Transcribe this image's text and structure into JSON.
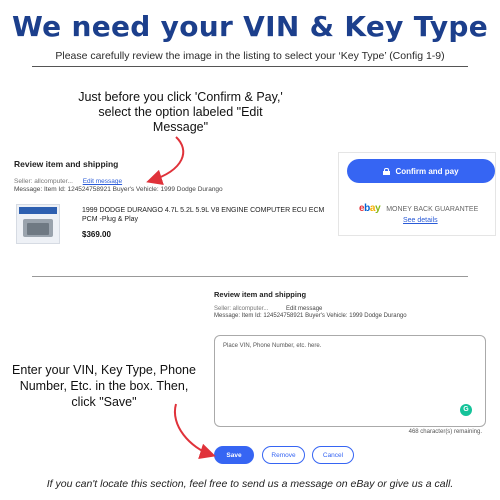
{
  "header": {
    "title": "We need your VIN & Key Type",
    "subtitle": "Please carefully review the image in the listing to select your ‘Key Type’ (Config 1-9)"
  },
  "callouts": {
    "top": "Just before you click 'Confirm & Pay,' select the option labeled \"Edit Message\"",
    "bottom": "Enter your VIN, Key Type, Phone Number, Etc.  in the box. Then, click \"Save\""
  },
  "checkout": {
    "section_title": "Review item and shipping",
    "seller_label": "Seller: allcomputer...",
    "edit_message_link": "Edit message",
    "message_line": "Message:  Item Id: 124524758921 Buyer's Vehicle: 1999 Dodge Durango",
    "item_title": "1999 DODGE DURANGO 4.7L 5.2L 5.9L V8 ENGINE COMPUTER ECU ECM PCM -Plug & Play",
    "price": "$369.00",
    "confirm_button": "Confirm and pay",
    "guarantee_text": "MONEY BACK GUARANTEE",
    "see_details": "See details",
    "ebay_letters": [
      "e",
      "b",
      "a",
      "y"
    ]
  },
  "edit_form": {
    "section_title": "Review item and shipping",
    "seller_label": "Seller: allcomputer...",
    "edit_message_label": "Edit message",
    "message_line": "Message:  Item Id: 124524758921 Buyer's Vehicle: 1999 Dodge Durango",
    "textarea_placeholder": "Place VIN, Phone Number, etc. here.",
    "char_counter": "468 character(s) remaining.",
    "save_button": "Save",
    "remove_button": "Remove",
    "cancel_button": "Cancel",
    "grammarly_letter": "G"
  },
  "footer": {
    "note": "If you can't locate this section, feel free to send us a message on eBay or give us a call."
  },
  "colors": {
    "headline": "#1c3f8c",
    "primary_button": "#3665f3",
    "arrow": "#e0323a"
  }
}
